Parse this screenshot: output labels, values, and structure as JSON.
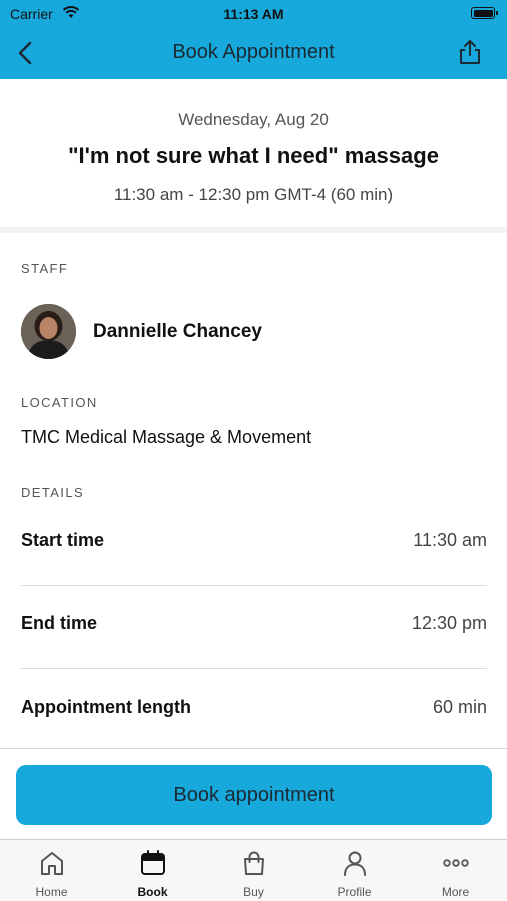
{
  "status_bar": {
    "carrier": "Carrier",
    "time": "11:13 AM"
  },
  "nav": {
    "title": "Book Appointment"
  },
  "summary": {
    "date": "Wednesday, Aug 20",
    "service": "\"I'm not sure what I need\" massage",
    "time_range": "11:30 am - 12:30 pm GMT-4 (60 min)"
  },
  "staff": {
    "section_label": "STAFF",
    "name": "Dannielle Chancey"
  },
  "location": {
    "section_label": "LOCATION",
    "name": "TMC Medical Massage & Movement"
  },
  "details": {
    "section_label": "DETAILS",
    "rows": [
      {
        "label": "Start time",
        "value": "11:30 am"
      },
      {
        "label": "End time",
        "value": "12:30 pm"
      },
      {
        "label": "Appointment length",
        "value": "60 min"
      }
    ]
  },
  "book_button": {
    "label": "Book appointment"
  },
  "tabs": [
    {
      "label": "Home",
      "icon": "home-icon",
      "active": false
    },
    {
      "label": "Book",
      "icon": "calendar-icon",
      "active": true
    },
    {
      "label": "Buy",
      "icon": "shopping-bag-icon",
      "active": false
    },
    {
      "label": "Profile",
      "icon": "person-icon",
      "active": false
    },
    {
      "label": "More",
      "icon": "more-icon",
      "active": false
    }
  ],
  "colors": {
    "accent": "#17a9dc",
    "divider": "#dcdcdc"
  }
}
